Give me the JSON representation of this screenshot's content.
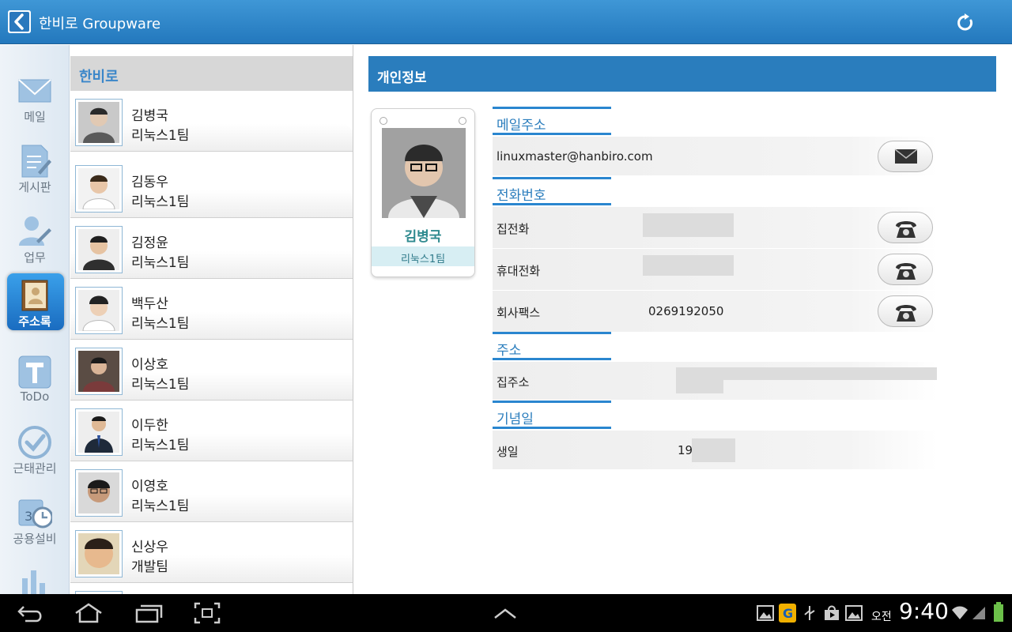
{
  "header": {
    "title": "한비로 Groupware"
  },
  "rail": {
    "items": [
      {
        "label": "메일",
        "icon": "mail-icon"
      },
      {
        "label": "게시판",
        "icon": "board-icon"
      },
      {
        "label": "업무",
        "icon": "task-icon"
      },
      {
        "label": "주소록",
        "icon": "address-book-icon",
        "active": true
      },
      {
        "label": "ToDo",
        "icon": "todo-icon"
      },
      {
        "label": "근태관리",
        "icon": "attendance-icon"
      },
      {
        "label": "공용설비",
        "icon": "calendar-clock-icon"
      }
    ]
  },
  "list": {
    "group": "한비로",
    "contacts": [
      {
        "name": "김병국",
        "team": "리눅스1팀"
      },
      {
        "name": "김동우",
        "team": "리눅스1팀"
      },
      {
        "name": "김정윤",
        "team": "리눅스1팀"
      },
      {
        "name": "백두산",
        "team": "리눅스1팀"
      },
      {
        "name": "이상호",
        "team": "리눅스1팀"
      },
      {
        "name": "이두한",
        "team": "리눅스1팀"
      },
      {
        "name": "이영호",
        "team": "리눅스1팀"
      },
      {
        "name": "신상우",
        "team": "개발팀"
      }
    ]
  },
  "detail": {
    "section_title": "개인정보",
    "card": {
      "name": "김병국",
      "team": "리눅스1팀"
    },
    "email_section": "메일주소",
    "email": "linuxmaster@hanbiro.com",
    "phone_section": "전화번호",
    "phones": [
      {
        "label": "집전화",
        "value": ""
      },
      {
        "label": "휴대전화",
        "value": ""
      },
      {
        "label": "회사팩스",
        "value": "0269192050"
      }
    ],
    "address_section": "주소",
    "address_label": "집주소",
    "anniv_section": "기념일",
    "birthday_label": "생일",
    "birthday_value": "19"
  },
  "system": {
    "ampm": "오전",
    "time": "9:40"
  },
  "colors": {
    "header_blue": "#2a7dbd",
    "accent": "#2a86cf",
    "card_name": "#2f8a8f"
  }
}
